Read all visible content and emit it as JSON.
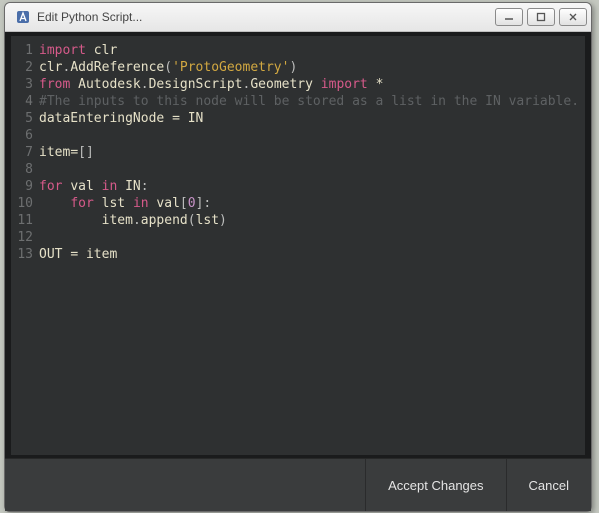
{
  "window": {
    "title": "Edit Python Script..."
  },
  "code": {
    "lines": [
      [
        {
          "t": "import",
          "c": "kw"
        },
        {
          "t": " ",
          "c": ""
        },
        {
          "t": "clr",
          "c": "ident"
        }
      ],
      [
        {
          "t": "clr",
          "c": "ident"
        },
        {
          "t": ".",
          "c": "dot"
        },
        {
          "t": "AddReference",
          "c": "ident"
        },
        {
          "t": "(",
          "c": "sym"
        },
        {
          "t": "'ProtoGeometry'",
          "c": "str"
        },
        {
          "t": ")",
          "c": "sym"
        }
      ],
      [
        {
          "t": "from",
          "c": "kw"
        },
        {
          "t": " ",
          "c": ""
        },
        {
          "t": "Autodesk",
          "c": "ident"
        },
        {
          "t": ".",
          "c": "dot"
        },
        {
          "t": "DesignScript",
          "c": "ident"
        },
        {
          "t": ".",
          "c": "dot"
        },
        {
          "t": "Geometry",
          "c": "ident"
        },
        {
          "t": " ",
          "c": ""
        },
        {
          "t": "import",
          "c": "kw"
        },
        {
          "t": " ",
          "c": ""
        },
        {
          "t": "*",
          "c": "op"
        }
      ],
      [
        {
          "t": "#The inputs to this node will be stored as a list in the IN variable.",
          "c": "comment"
        }
      ],
      [
        {
          "t": "dataEnteringNode",
          "c": "ident"
        },
        {
          "t": " ",
          "c": ""
        },
        {
          "t": "=",
          "c": "op"
        },
        {
          "t": " ",
          "c": ""
        },
        {
          "t": "IN",
          "c": "ident"
        }
      ],
      [],
      [
        {
          "t": "item",
          "c": "ident"
        },
        {
          "t": "=",
          "c": "op"
        },
        {
          "t": "[]",
          "c": "sym"
        }
      ],
      [],
      [
        {
          "t": "for",
          "c": "kw"
        },
        {
          "t": " ",
          "c": ""
        },
        {
          "t": "val",
          "c": "ident"
        },
        {
          "t": " ",
          "c": ""
        },
        {
          "t": "in",
          "c": "kw"
        },
        {
          "t": " ",
          "c": ""
        },
        {
          "t": "IN",
          "c": "ident"
        },
        {
          "t": ":",
          "c": "sym"
        }
      ],
      [
        {
          "t": "    ",
          "c": ""
        },
        {
          "t": "for",
          "c": "kw"
        },
        {
          "t": " ",
          "c": ""
        },
        {
          "t": "lst",
          "c": "ident"
        },
        {
          "t": " ",
          "c": ""
        },
        {
          "t": "in",
          "c": "kw"
        },
        {
          "t": " ",
          "c": ""
        },
        {
          "t": "val",
          "c": "ident"
        },
        {
          "t": "[",
          "c": "sym"
        },
        {
          "t": "0",
          "c": "num"
        },
        {
          "t": "]",
          "c": "sym"
        },
        {
          "t": ":",
          "c": "sym"
        }
      ],
      [
        {
          "t": "        ",
          "c": ""
        },
        {
          "t": "item",
          "c": "ident"
        },
        {
          "t": ".",
          "c": "dot"
        },
        {
          "t": "append",
          "c": "ident"
        },
        {
          "t": "(",
          "c": "sym"
        },
        {
          "t": "lst",
          "c": "ident"
        },
        {
          "t": ")",
          "c": "sym"
        }
      ],
      [],
      [
        {
          "t": "OUT",
          "c": "ident"
        },
        {
          "t": " ",
          "c": ""
        },
        {
          "t": "=",
          "c": "op"
        },
        {
          "t": " ",
          "c": ""
        },
        {
          "t": "item",
          "c": "ident"
        }
      ]
    ]
  },
  "buttons": {
    "accept": "Accept Changes",
    "cancel": "Cancel"
  }
}
